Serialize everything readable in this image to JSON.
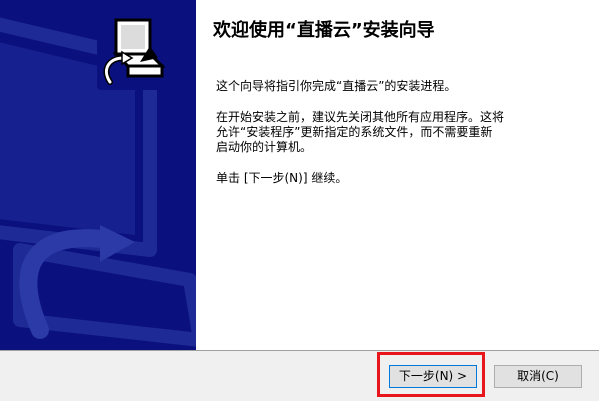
{
  "wizard": {
    "title": "欢迎使用“直播云”安装向导",
    "para1": "这个向导将指引你完成“直播云”的安装进程。",
    "para2_line1": "在开始安装之前，建议先关闭其他所有应用程序。这将",
    "para2_line2": "允许“安装程序”更新指定的系统文件，而不需要重新",
    "para2_line3": "启动你的计算机。",
    "para3": "单击 [下一步(N)] 继续。"
  },
  "buttons": {
    "next_label": "下一步(N) >",
    "cancel_label": "取消(C)"
  },
  "colors": {
    "side_panel": "#0b107f",
    "highlight": "#e8151b"
  },
  "icons": {
    "installer": "installer-computer-icon"
  }
}
